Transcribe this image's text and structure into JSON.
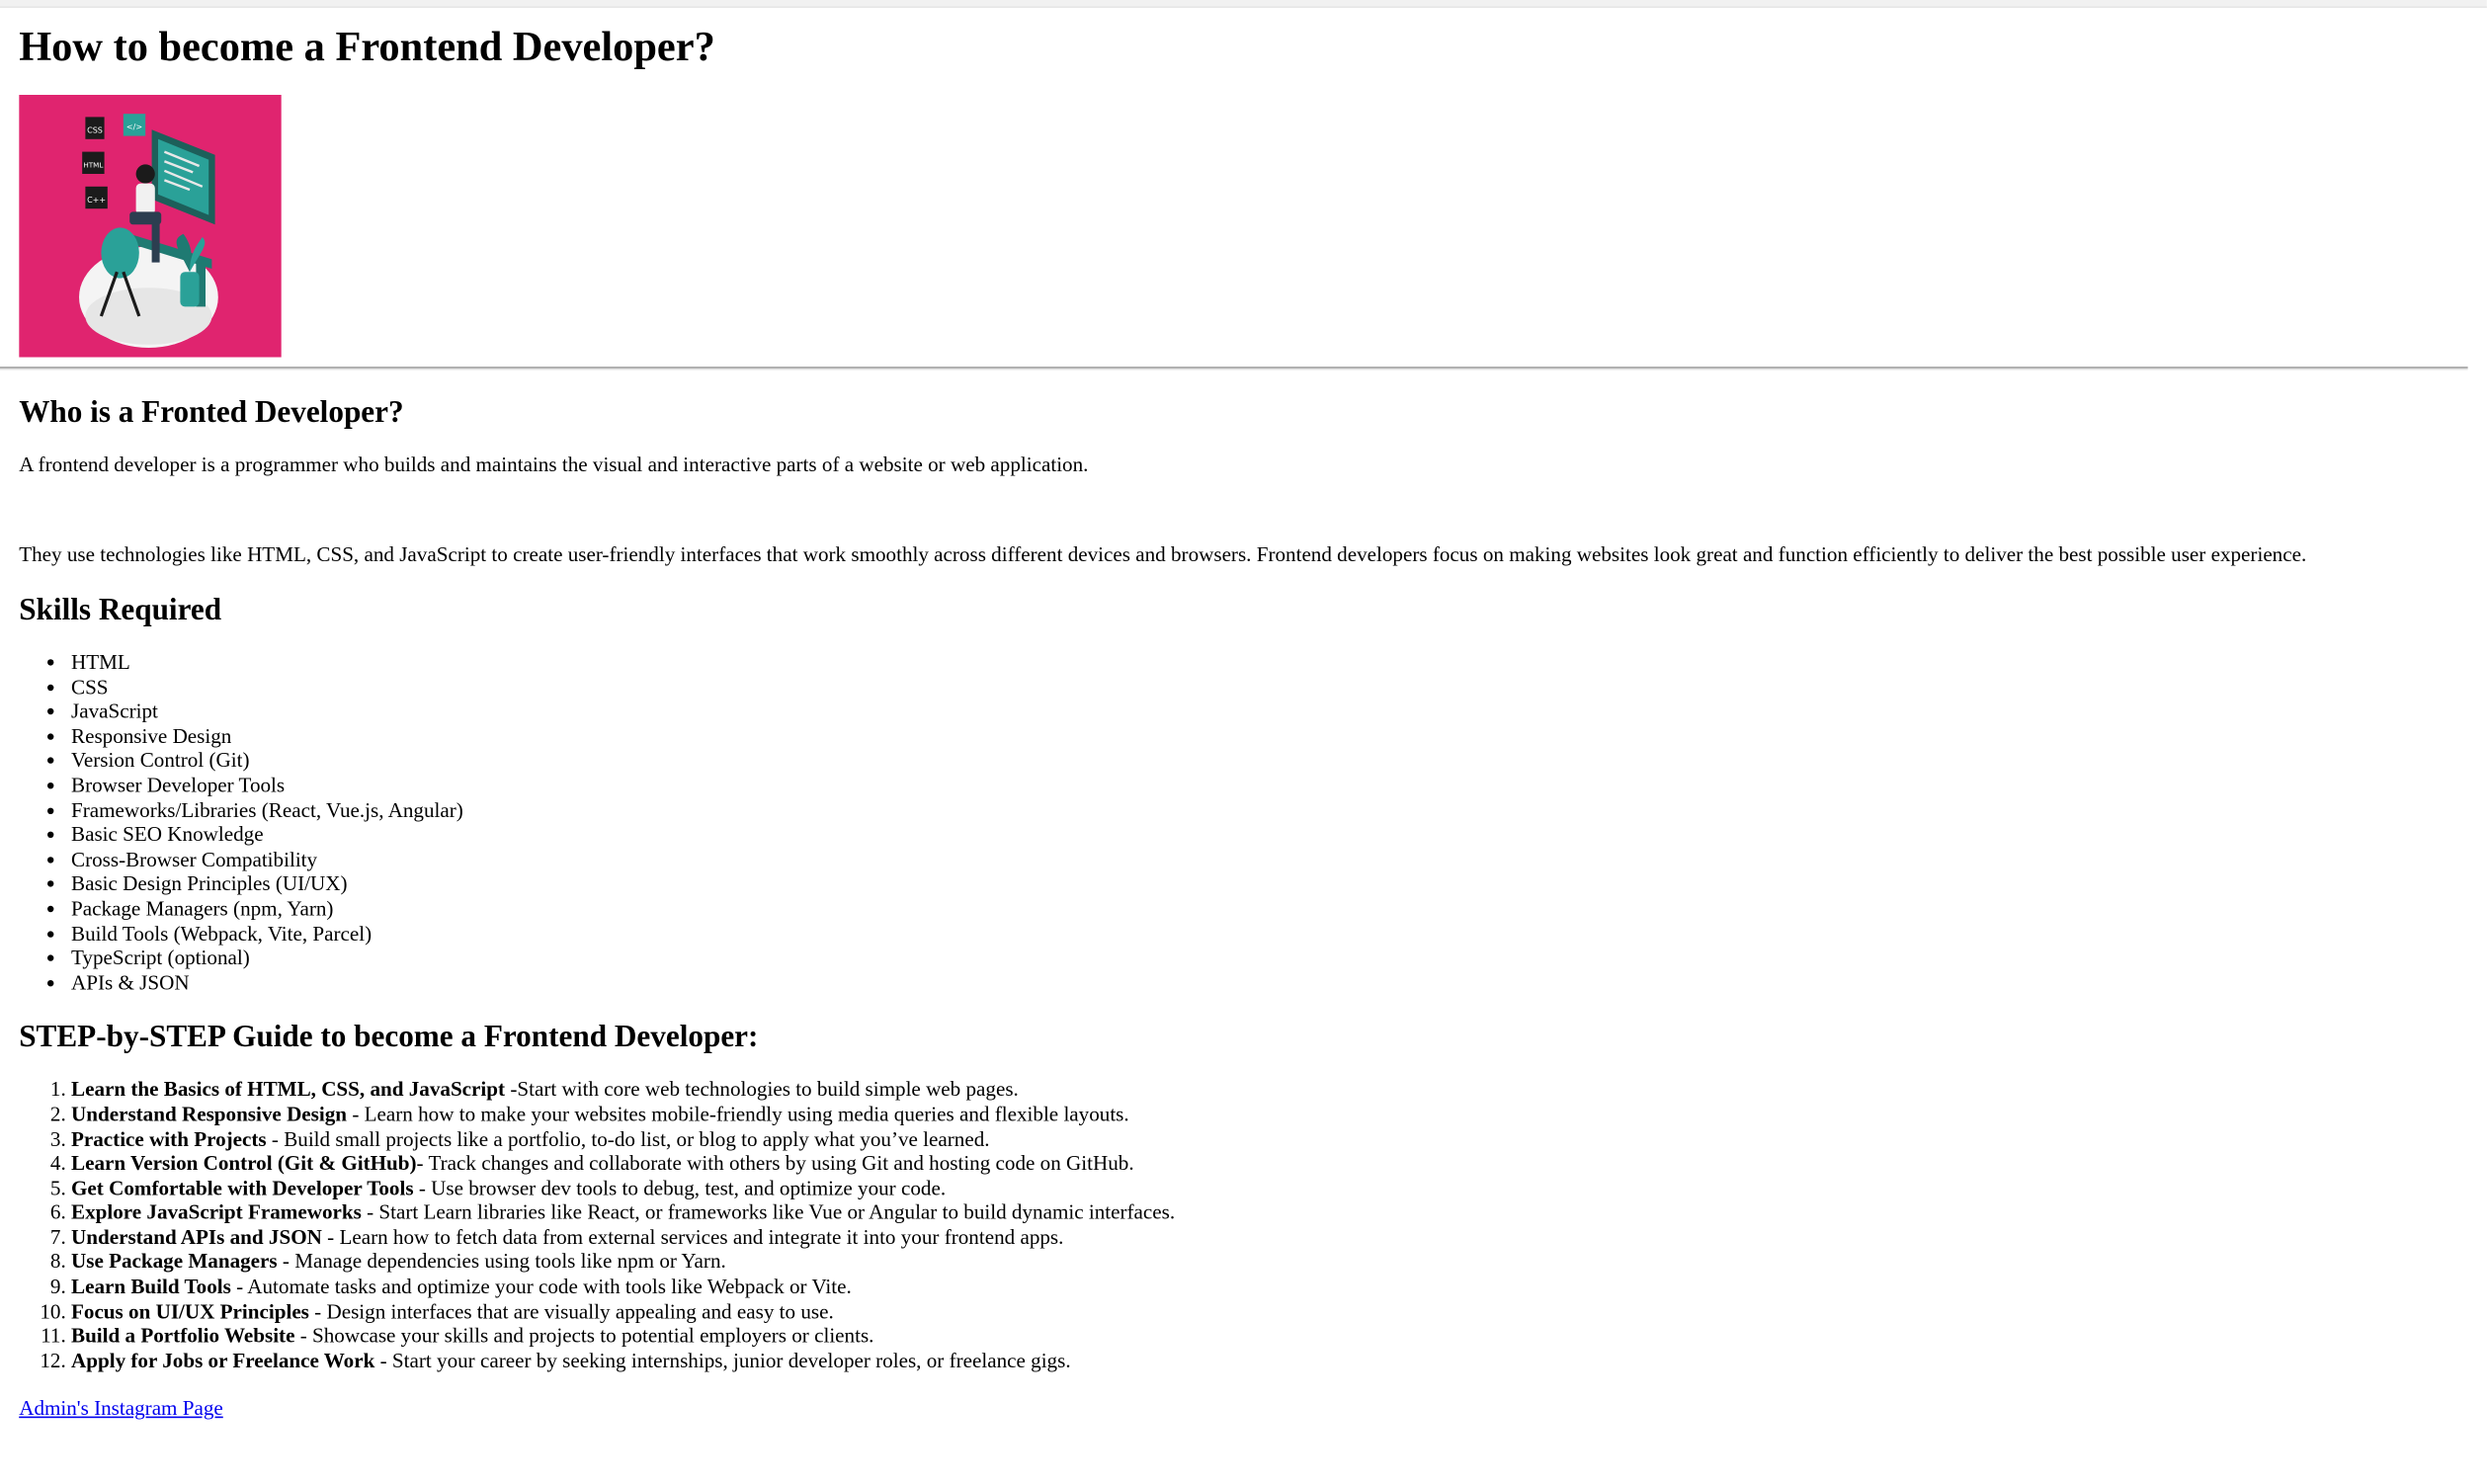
{
  "page": {
    "title": "How to become a Frontend Developer?"
  },
  "hero_image": {
    "icon": "frontend-developer-illustration",
    "background_color": "#e0246f",
    "badges": [
      "CSS",
      "</>",
      "HTML",
      "C++"
    ]
  },
  "who": {
    "heading": "Who is a Fronted Developer?",
    "paragraph1": "A frontend developer is a programmer who builds and maintains the visual and interactive parts of a website or web application.",
    "paragraph2": "They use technologies like HTML, CSS, and JavaScript to create user-friendly interfaces that work smoothly across different devices and browsers. Frontend developers focus on making websites look great and function efficiently to deliver the best possible user experience."
  },
  "skills": {
    "heading": "Skills Required",
    "items": [
      "HTML",
      "CSS",
      "JavaScript",
      "Responsive Design",
      "Version Control (Git)",
      "Browser Developer Tools",
      "Frameworks/Libraries (React, Vue.js, Angular)",
      "Basic SEO Knowledge",
      "Cross-Browser Compatibility",
      "Basic Design Principles (UI/UX)",
      "Package Managers (npm, Yarn)",
      "Build Tools (Webpack, Vite, Parcel)",
      "TypeScript (optional)",
      "APIs & JSON"
    ]
  },
  "guide": {
    "heading": "STEP-by-STEP Guide to become a Frontend Developer:",
    "steps": [
      {
        "title": "Learn the Basics of HTML, CSS, and JavaScript",
        "text": " -Start with core web technologies to build simple web pages."
      },
      {
        "title": "Understand Responsive Design",
        "text": " - Learn how to make your websites mobile-friendly using media queries and flexible layouts."
      },
      {
        "title": "Practice with Projects",
        "text": " - Build small projects like a portfolio, to-do list, or blog to apply what you’ve learned."
      },
      {
        "title": "Learn Version Control (Git & GitHub)",
        "text": "- Track changes and collaborate with others by using Git and hosting code on GitHub."
      },
      {
        "title": "Get Comfortable with Developer Tools",
        "text": " - Use browser dev tools to debug, test, and optimize your code."
      },
      {
        "title": "Explore JavaScript Frameworks",
        "text": " - Start Learn libraries like React, or frameworks like Vue or Angular to build dynamic interfaces."
      },
      {
        "title": "Understand APIs and JSON",
        "text": " - Learn how to fetch data from external services and integrate it into your frontend apps."
      },
      {
        "title": "Use Package Managers",
        "text": " - Manage dependencies using tools like npm or Yarn."
      },
      {
        "title": "Learn Build Tools",
        "text": " - Automate tasks and optimize your code with tools like Webpack or Vite."
      },
      {
        "title": "Focus on UI/UX Principles",
        "text": " - Design interfaces that are visually appealing and easy to use."
      },
      {
        "title": "Build a Portfolio Website",
        "text": " - Showcase your skills and projects to potential employers or clients."
      },
      {
        "title": "Apply for Jobs or Freelance Work",
        "text": " - Start your career by seeking internships, junior developer roles, or freelance gigs."
      }
    ]
  },
  "footer": {
    "instagram_link": "Admin's Instagram Page"
  }
}
